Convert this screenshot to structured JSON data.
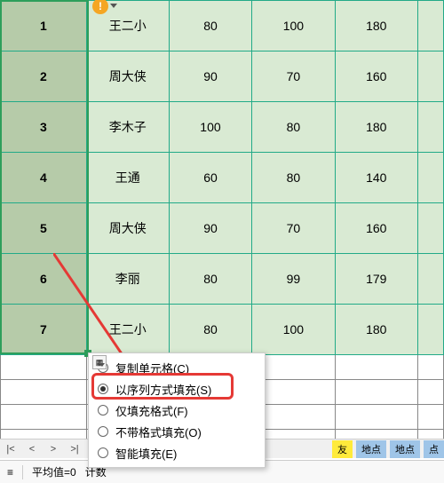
{
  "warn_badge": "!",
  "table": {
    "rows": [
      {
        "n": "1",
        "name": "王二小",
        "c1": "80",
        "c2": "100",
        "c3": "180"
      },
      {
        "n": "2",
        "name": "周大侠",
        "c1": "90",
        "c2": "70",
        "c3": "160"
      },
      {
        "n": "3",
        "name": "李木子",
        "c1": "100",
        "c2": "80",
        "c3": "180"
      },
      {
        "n": "4",
        "name": "王通",
        "c1": "60",
        "c2": "80",
        "c3": "140"
      },
      {
        "n": "5",
        "name": "周大侠",
        "c1": "90",
        "c2": "70",
        "c3": "160"
      },
      {
        "n": "6",
        "name": "李丽",
        "c1": "80",
        "c2": "99",
        "c3": "179"
      },
      {
        "n": "7",
        "name": "王二小",
        "c1": "80",
        "c2": "100",
        "c3": "180"
      }
    ]
  },
  "fill_menu": {
    "copy": "复制单元格(C)",
    "series": "以序列方式填充(S)",
    "formats": "仅填充格式(F)",
    "no_format": "不带格式填充(O)",
    "smart": "智能填充(E)"
  },
  "bottom": {
    "tab_yellow": "友",
    "tab_blue1": "地点",
    "tab_blue2": "地点",
    "tab_blue3": "点"
  },
  "status": {
    "avg_label": "平均值=",
    "avg_val": "0",
    "count_label": "计数"
  }
}
